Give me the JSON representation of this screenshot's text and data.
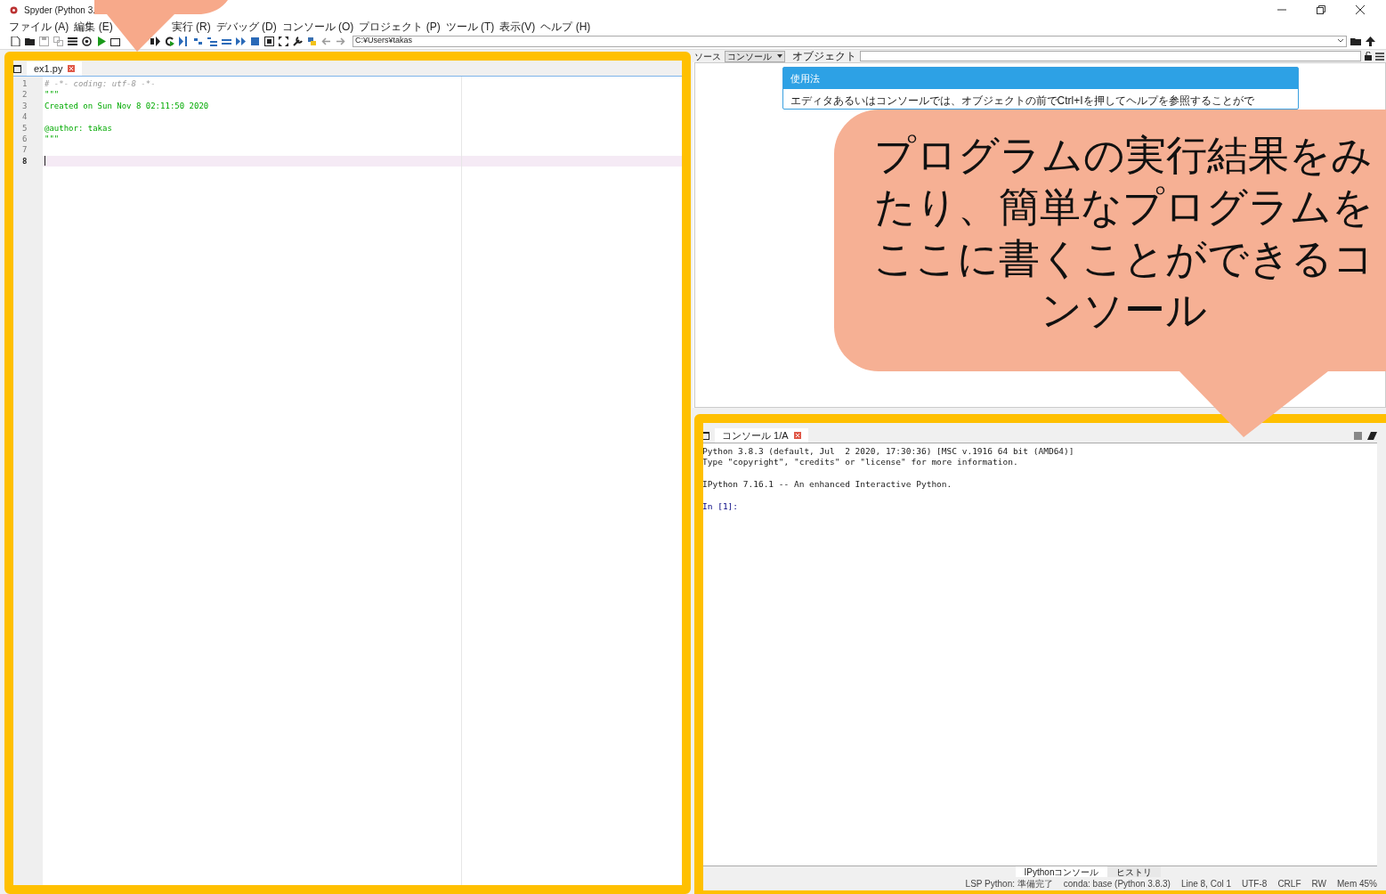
{
  "window": {
    "title": "Spyder (Python 3."
  },
  "menu": [
    {
      "label": "ファイル (A)"
    },
    {
      "label": "編集 (E)"
    },
    {
      "label": "実行 (R)"
    },
    {
      "label": "デバッグ (D)"
    },
    {
      "label": "コンソール (O)"
    },
    {
      "label": "プロジェクト (P)"
    },
    {
      "label": "ツール (T)"
    },
    {
      "label": "表示(V)"
    },
    {
      "label": "ヘルプ (H)"
    }
  ],
  "toolbar": {
    "path": "C:¥Users¥takas"
  },
  "editor": {
    "tabs": [
      {
        "label": "ex1.py",
        "selected": true
      }
    ],
    "lines": [
      {
        "number": "1",
        "text": "# -*- coding: utf-8 -*-",
        "kind": "comment",
        "current": false
      },
      {
        "number": "2",
        "text": "\"\"\"",
        "kind": "string",
        "current": false
      },
      {
        "number": "3",
        "text": "Created on Sun Nov  8 02:11:50 2020",
        "kind": "string",
        "current": false
      },
      {
        "number": "4",
        "kind": "string",
        "current": false
      },
      {
        "number": "5",
        "text": "@author: takas",
        "kind": "string",
        "current": false
      },
      {
        "number": "6",
        "text": "\"\"\"",
        "kind": "string",
        "current": false
      },
      {
        "number": "7",
        "kind": "code",
        "current": false
      },
      {
        "number": "8",
        "kind": "code",
        "current": true
      }
    ]
  },
  "help_pane": {
    "source_label": "ソース",
    "source_value": "コンソール",
    "object_label": "オブジェクト",
    "title": "使用法",
    "text": "エディタあるいはコンソールでは、オブジェクトの前でCtrl+Iを押してヘルプを参照することがで"
  },
  "console": {
    "tabs": [
      {
        "label": "コンソール 1/A",
        "selected": true
      }
    ],
    "lines": [
      {
        "text": "Python 3.8.3 (default, Jul  2 2020, 17:30:36) [MSC v.1916 64 bit (AMD64)]",
        "kind": "output"
      },
      {
        "text": "Type \"copyright\", \"credits\" or \"license\" for more information.",
        "kind": "output"
      },
      {
        "kind": "blank"
      },
      {
        "text": "IPython 7.16.1 -- An enhanced Interactive Python.",
        "kind": "output"
      },
      {
        "kind": "blank"
      },
      {
        "text": "In [1]:",
        "kind": "prompt"
      }
    ],
    "bottom_tabs": [
      {
        "label": "IPythonコンソール",
        "selected": true
      },
      {
        "label": "ヒストリ",
        "selected": false
      }
    ]
  },
  "status_bar": [
    "LSP Python: 準備完了",
    "conda: base (Python 3.8.3)",
    "Line 8, Col 1",
    "UTF-8",
    "CRLF",
    "RW",
    "Mem 45%"
  ],
  "annotations": [
    {
      "kind": "frame"
    },
    {
      "kind": "frame"
    },
    {
      "kind": "callout"
    },
    {
      "kind": "callout",
      "text": "プログラムの実行結果をみたり、簡単なプログラムをここに書くことができるコンソール"
    }
  ]
}
